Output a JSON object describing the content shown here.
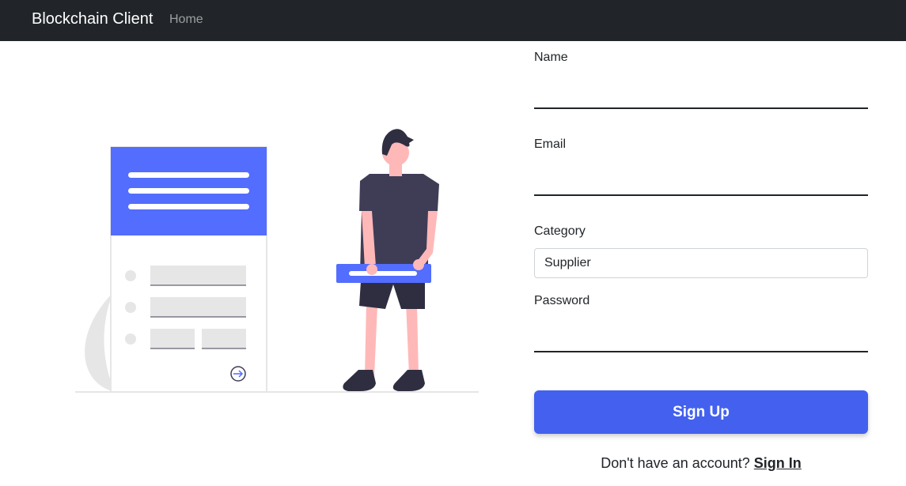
{
  "navbar": {
    "brand": "Blockchain Client",
    "links": [
      {
        "label": "Home"
      }
    ]
  },
  "form": {
    "name_label": "Name",
    "name_value": "",
    "email_label": "Email",
    "email_value": "",
    "category_label": "Category",
    "category_value": "Supplier",
    "password_label": "Password",
    "password_value": "",
    "submit_label": "Sign Up"
  },
  "footer": {
    "prompt": "Don't have an account?",
    "link_label": "Sign In"
  },
  "colors": {
    "navbar_bg": "#212529",
    "accent": "#4361ee",
    "illustration_accent": "#536dfe"
  }
}
